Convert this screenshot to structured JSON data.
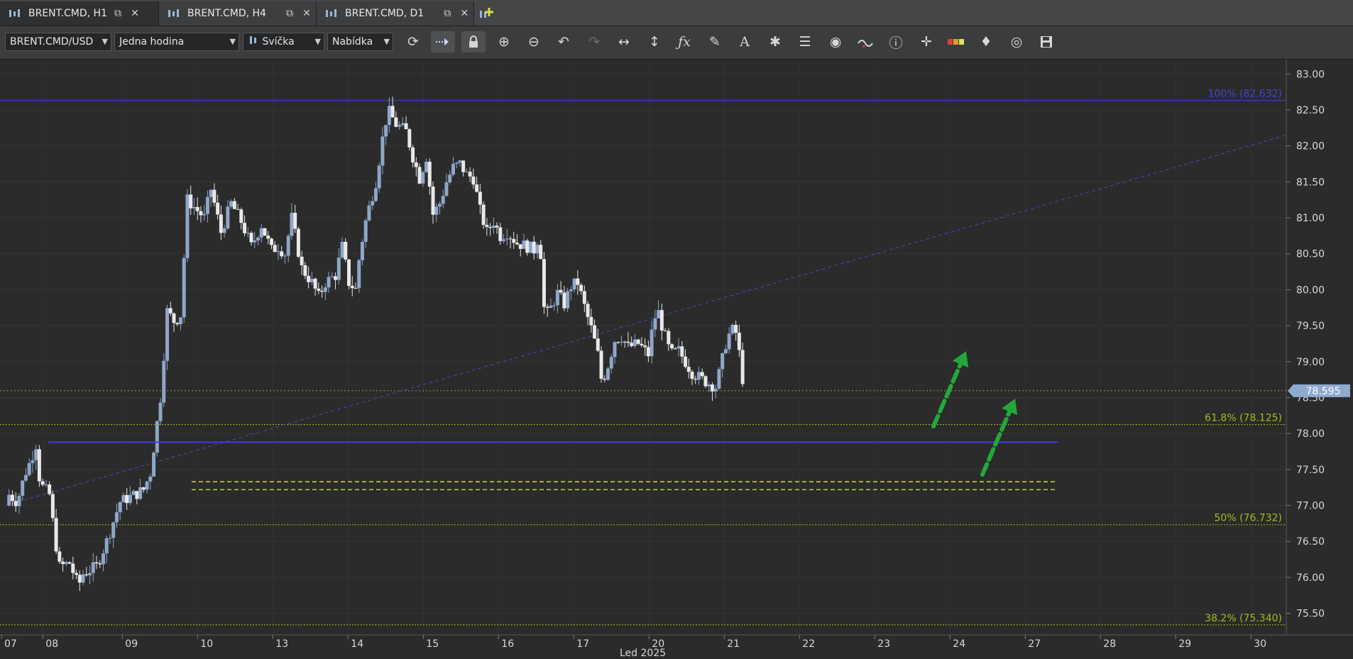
{
  "tabs": [
    {
      "label": "BRENT.CMD, H1",
      "active": true
    },
    {
      "label": "BRENT.CMD, H4",
      "active": false
    },
    {
      "label": "BRENT.CMD, D1",
      "active": false
    }
  ],
  "toolbar": {
    "instrument": "BRENT.CMD/USD",
    "period": "Jedna hodina",
    "chart_type": "Svíčka",
    "price_side": "Nabídka",
    "buttons": [
      "refresh-icon",
      "autoscroll-icon",
      "lock-icon",
      "zoom-in-icon",
      "zoom-out-icon",
      "undo-icon",
      "redo-icon",
      "horizontal-stretch-icon",
      "vertical-stretch-icon",
      "indicators-icon",
      "pencil-icon",
      "text-icon",
      "patterns-icon",
      "layers-icon",
      "eye-icon",
      "theme-icon",
      "info-icon",
      "crosshair-icon",
      "spread-icon",
      "paint-icon",
      "reset-icon",
      "save-icon"
    ]
  },
  "colors": {
    "bg": "#2b2b2b",
    "bull": "#8fa6c8",
    "bear": "#e8e8e8",
    "fib": "#9fbf1f",
    "fib100": "#4444cc",
    "support": "#3a3aee",
    "zone": "#e6e64a",
    "arrow": "#22a83a",
    "price_marker": "#8fa9cf"
  },
  "chart_data": {
    "type": "candlestick",
    "symbol": "BRENT.CMD",
    "timeframe": "H1",
    "y_ticks": [
      "83.00",
      "82.50",
      "82.00",
      "81.50",
      "81.00",
      "80.50",
      "80.00",
      "79.50",
      "79.00",
      "78.50",
      "78.00",
      "77.50",
      "77.00",
      "76.50",
      "76.00",
      "75.50"
    ],
    "ylim": [
      75.2,
      83.2
    ],
    "x_ticks": [
      "07",
      "08",
      "09",
      "10",
      "13",
      "14",
      "15",
      "16",
      "17",
      "20",
      "21",
      "22",
      "23",
      "24",
      "27",
      "28",
      "29",
      "30"
    ],
    "x_axis_title": "Led 2025",
    "current_price": "78.595",
    "fib_levels": [
      {
        "label": "100% (82.632)",
        "value": 82.632
      },
      {
        "label": "61.8% (78.125)",
        "value": 78.125
      },
      {
        "label": "50% (76.732)",
        "value": 76.732
      },
      {
        "label": "38.2% (75.340)",
        "value": 75.34
      }
    ],
    "dotted_level": 78.595,
    "support_line": 77.88,
    "zone_lines": [
      77.33,
      77.22
    ],
    "trend_line": {
      "from_day": "07",
      "from": 77.0,
      "to_day": "30",
      "to": 82.15
    },
    "anchors": [
      [
        0,
        77.0
      ],
      [
        0.5,
        77.15
      ],
      [
        1.7,
        77.05
      ],
      [
        2.9,
        77.45
      ],
      [
        3.6,
        77.6
      ],
      [
        4.5,
        77.85
      ],
      [
        5.1,
        77.3
      ],
      [
        6.5,
        77.15
      ],
      [
        7.3,
        76.55
      ],
      [
        8.0,
        76.15
      ],
      [
        9.5,
        76.2
      ],
      [
        10.8,
        75.88
      ],
      [
        11.5,
        76.05
      ],
      [
        13.5,
        76.15
      ],
      [
        15.0,
        76.5
      ],
      [
        17.0,
        77.05
      ],
      [
        19.2,
        77.15
      ],
      [
        20.5,
        77.22
      ],
      [
        21.5,
        77.45
      ],
      [
        23.0,
        78.5
      ],
      [
        24.0,
        79.7
      ],
      [
        25.1,
        79.55
      ],
      [
        26.0,
        79.65
      ],
      [
        27.0,
        81.25
      ],
      [
        29.5,
        81.0
      ],
      [
        30.5,
        81.4
      ],
      [
        32.0,
        80.8
      ],
      [
        33.5,
        81.2
      ],
      [
        35.0,
        80.95
      ],
      [
        36.5,
        80.6
      ],
      [
        38.0,
        80.9
      ],
      [
        39.5,
        80.55
      ],
      [
        40.5,
        80.6
      ],
      [
        41.5,
        80.5
      ],
      [
        42.5,
        81.0
      ],
      [
        44.0,
        80.3
      ],
      [
        45.5,
        80.1
      ],
      [
        46.5,
        79.9
      ],
      [
        47.5,
        80.1
      ],
      [
        49.0,
        80.2
      ],
      [
        50.0,
        80.6
      ],
      [
        51.0,
        80.1
      ],
      [
        52.0,
        80.0
      ],
      [
        52.6,
        80.5
      ],
      [
        53.6,
        81.0
      ],
      [
        55.0,
        81.5
      ],
      [
        56.0,
        82.1
      ],
      [
        56.8,
        82.5
      ],
      [
        58.0,
        82.3
      ],
      [
        59.5,
        82.2
      ],
      [
        60.5,
        81.85
      ],
      [
        61.5,
        81.55
      ],
      [
        62.5,
        81.85
      ],
      [
        63.5,
        81.05
      ],
      [
        64.5,
        81.2
      ],
      [
        65.5,
        81.5
      ],
      [
        66.5,
        81.7
      ],
      [
        67.5,
        81.75
      ],
      [
        68.5,
        81.6
      ],
      [
        69.5,
        81.55
      ],
      [
        70.5,
        81.1
      ],
      [
        71.5,
        80.8
      ],
      [
        72.5,
        80.95
      ],
      [
        73.5,
        80.75
      ],
      [
        74.5,
        80.8
      ],
      [
        76.0,
        80.65
      ],
      [
        77.5,
        80.6
      ],
      [
        78.6,
        80.55
      ],
      [
        79.3,
        80.8
      ],
      [
        80.1,
        79.6
      ],
      [
        81.0,
        79.75
      ],
      [
        82.0,
        79.95
      ],
      [
        83.0,
        79.8
      ],
      [
        84.0,
        80.05
      ],
      [
        85.0,
        80.1
      ],
      [
        86.2,
        79.7
      ],
      [
        87.2,
        79.4
      ],
      [
        88.0,
        79.1
      ],
      [
        88.6,
        78.7
      ],
      [
        89.5,
        78.95
      ],
      [
        90.5,
        79.3
      ],
      [
        91.5,
        79.35
      ],
      [
        92.5,
        79.2
      ],
      [
        94.0,
        79.25
      ],
      [
        95.5,
        79.1
      ],
      [
        96.0,
        79.4
      ],
      [
        96.8,
        79.75
      ],
      [
        97.8,
        79.4
      ],
      [
        98.8,
        79.1
      ],
      [
        100.0,
        79.15
      ],
      [
        101.0,
        79.0
      ],
      [
        102.0,
        78.85
      ],
      [
        103.5,
        78.75
      ],
      [
        104.5,
        78.7
      ],
      [
        105.5,
        78.65
      ],
      [
        106.2,
        78.9
      ],
      [
        107.0,
        79.25
      ],
      [
        107.8,
        79.45
      ],
      [
        108.5,
        79.4
      ],
      [
        109.2,
        79.0
      ],
      [
        109.7,
        78.6
      ]
    ]
  }
}
